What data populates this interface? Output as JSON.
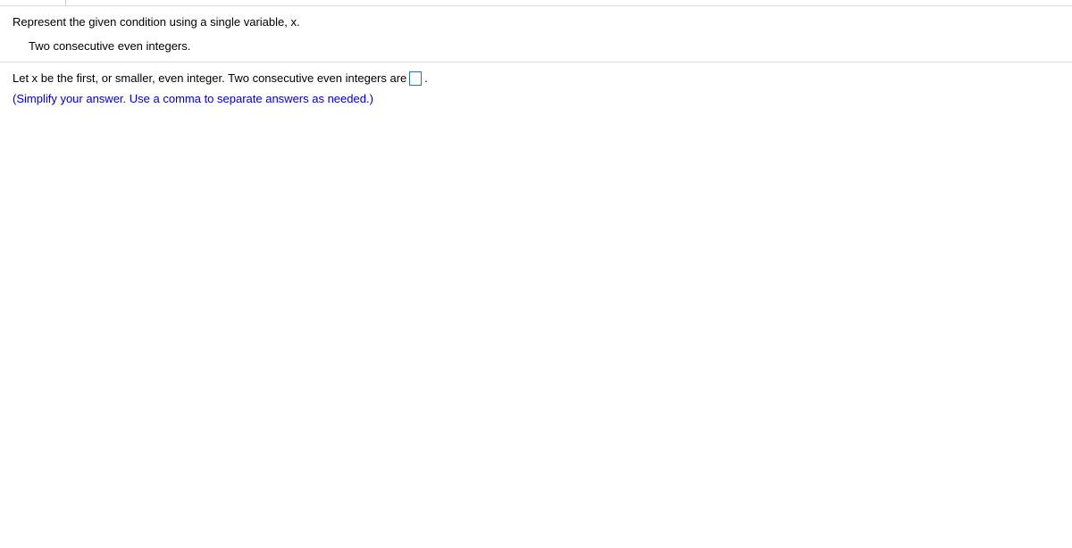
{
  "question": {
    "prompt": "Represent the given condition using a single variable, x.",
    "condition": "Two consecutive even integers."
  },
  "answer": {
    "lead_text": "Let x be the first, or smaller, even integer. Two consecutive even integers are ",
    "trail_text": ".",
    "input_value": "",
    "hint": "(Simplify your answer. Use a comma to separate answers as needed.)"
  }
}
